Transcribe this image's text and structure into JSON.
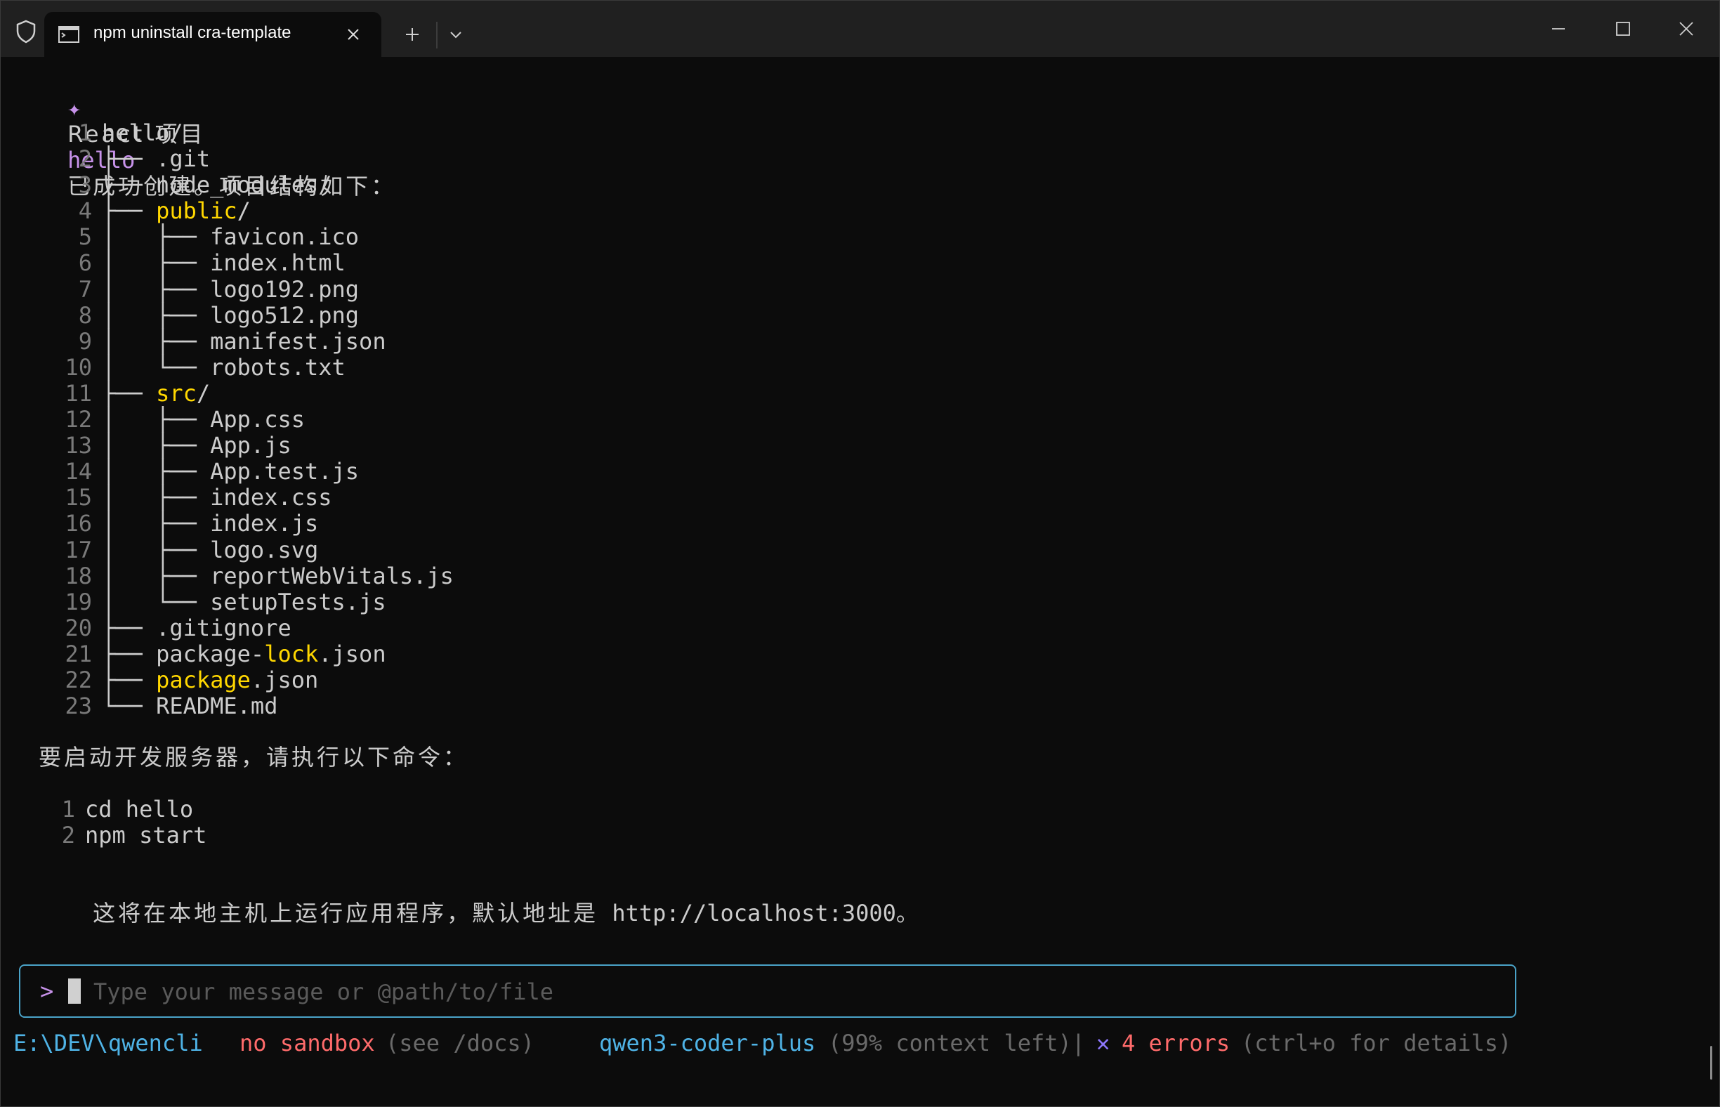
{
  "tab": {
    "title": "npm uninstall cra-template"
  },
  "message": {
    "star": "✦",
    "part1": "React 项目",
    "project": "hello",
    "part2": "已成功创建。项目结构如下："
  },
  "tree": [
    {
      "n": "1",
      "prefix": "",
      "name": "hello/",
      "hl": ""
    },
    {
      "n": "2",
      "prefix": "├── ",
      "name": ".git",
      "hl": ""
    },
    {
      "n": "3",
      "prefix": "├── ",
      "name": "node_modules/",
      "hl": ""
    },
    {
      "n": "4",
      "prefix": "├── ",
      "name": "/",
      "hl": "public"
    },
    {
      "n": "5",
      "prefix": "│   ├── ",
      "name": "favicon.ico",
      "hl": ""
    },
    {
      "n": "6",
      "prefix": "│   ├── ",
      "name": "index.html",
      "hl": ""
    },
    {
      "n": "7",
      "prefix": "│   ├── ",
      "name": "logo192.png",
      "hl": ""
    },
    {
      "n": "8",
      "prefix": "│   ├── ",
      "name": "logo512.png",
      "hl": ""
    },
    {
      "n": "9",
      "prefix": "│   ├── ",
      "name": "manifest.json",
      "hl": ""
    },
    {
      "n": "10",
      "prefix": "│   └── ",
      "name": "robots.txt",
      "hl": ""
    },
    {
      "n": "11",
      "prefix": "├── ",
      "name": "/",
      "hl": "src"
    },
    {
      "n": "12",
      "prefix": "│   ├── ",
      "name": "App.css",
      "hl": ""
    },
    {
      "n": "13",
      "prefix": "│   ├── ",
      "name": "App.js",
      "hl": ""
    },
    {
      "n": "14",
      "prefix": "│   ├── ",
      "name": "App.test.js",
      "hl": ""
    },
    {
      "n": "15",
      "prefix": "│   ├── ",
      "name": "index.css",
      "hl": ""
    },
    {
      "n": "16",
      "prefix": "│   ├── ",
      "name": "index.js",
      "hl": ""
    },
    {
      "n": "17",
      "prefix": "│   ├── ",
      "name": "logo.svg",
      "hl": ""
    },
    {
      "n": "18",
      "prefix": "│   ├── ",
      "name": "reportWebVitals.js",
      "hl": ""
    },
    {
      "n": "19",
      "prefix": "│   └── ",
      "name": "setupTests.js",
      "hl": ""
    },
    {
      "n": "20",
      "prefix": "├── ",
      "name": ".gitignore",
      "hl": ""
    },
    {
      "n": "21",
      "prefix": "├── ",
      "name": "package-|lock|.json",
      "hl": "mid"
    },
    {
      "n": "22",
      "prefix": "├── ",
      "name": ".json",
      "hl": "package"
    },
    {
      "n": "23",
      "prefix": "└── ",
      "name": "README.md",
      "hl": ""
    }
  ],
  "start_text": "要启动开发服务器，请执行以下命令：",
  "commands": [
    {
      "n": "1",
      "text": "cd hello"
    },
    {
      "n": "2",
      "text": "npm start"
    }
  ],
  "footer": {
    "part1": "这将在本地主机上运行应用程序，默认地址是",
    "url": " http://localhost:3000。"
  },
  "input": {
    "prompt": ">",
    "placeholder": "Type your message or @path/to/file"
  },
  "status": {
    "path": "E:\\DEV\\qwencli",
    "sandbox": "no sandbox",
    "sandbox_hint": "(see /docs)",
    "model": "qwen3-coder-plus",
    "context": "(99% context left)|",
    "error_mark": "✕",
    "errors": "4 errors",
    "errors_hint": "(ctrl+o for details)"
  },
  "colors": {
    "accent": "#4aa3c8",
    "purple": "#c792ea",
    "yellow": "#ffd700",
    "error": "#ff6b6b",
    "cyan": "#4fb3e6"
  }
}
